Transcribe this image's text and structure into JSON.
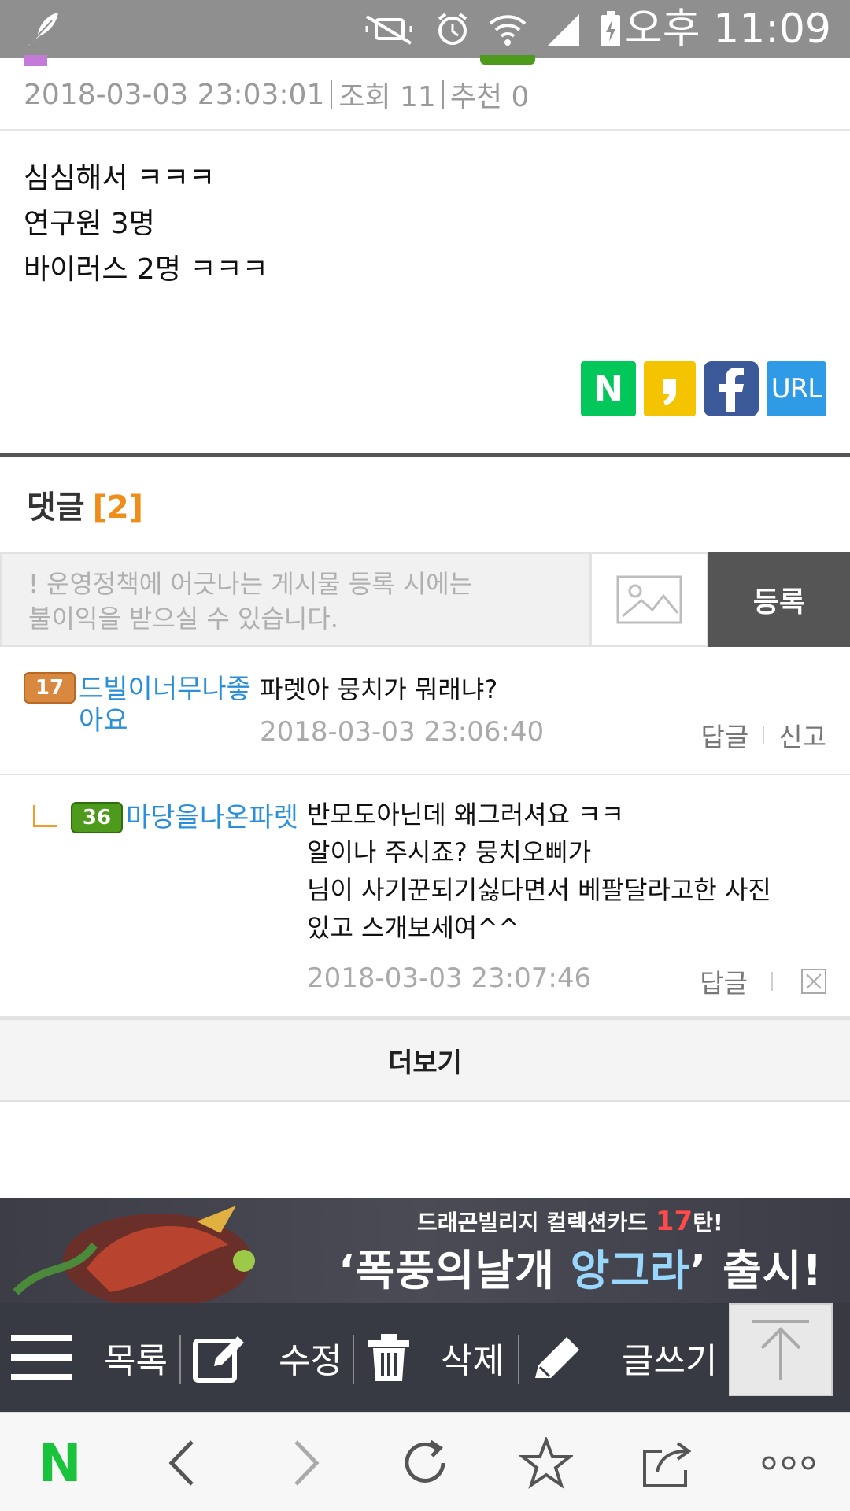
{
  "status_bar": {
    "time": "오후 11:09",
    "icons": [
      "feather-icon",
      "mute-icon",
      "alarm-icon",
      "wifi-icon",
      "signal-icon",
      "battery-charging-icon"
    ]
  },
  "post": {
    "date": "2018-03-03 23:03:01",
    "views": "조회 11",
    "recommend": "추천 0",
    "body_lines": [
      "심심해서 ㅋㅋㅋ",
      "연구원 3명",
      "바이러스 2명 ㅋㅋㅋ"
    ]
  },
  "share": {
    "naver_label": "N",
    "url_label": "URL"
  },
  "comments_header": {
    "title": "댓글",
    "count": "[2]"
  },
  "comment_form": {
    "placeholder_line1": "! 운영정책에 어긋나는 게시물 등록 시에는",
    "placeholder_line2": "불이익을 받으실 수 있습니다.",
    "submit_label": "등록"
  },
  "comments": [
    {
      "level": "17",
      "nick_line1": "드빌이너무나좋",
      "nick_line2": "아요",
      "text": "파렛아 뭉치가 뭐래냐?",
      "date": "2018-03-03 23:06:40",
      "reply_label": "답글",
      "report_label": "신고"
    },
    {
      "level": "36",
      "nick": "마당을나온파렛",
      "text_lines": [
        "반모도아닌데 왜그러셔요 ㅋㅋ",
        "알이나 주시죠? 뭉치오삐가",
        "님이 사기꾼되기싫다면서 베팔달라고한 사진",
        "있고 스개보세여^^"
      ],
      "date": "2018-03-03 23:07:46",
      "reply_label": "답글"
    }
  ],
  "more_label": "더보기",
  "banner": {
    "sub_pre": "드래곤빌리지 컬렉션카드 ",
    "sub_num": "17",
    "sub_post": "탄!",
    "main_pre": "‘폭풍의날개 ",
    "main_hl": "앙그라",
    "main_post": "’ 출시!"
  },
  "actionbar": {
    "list_label": "목록",
    "edit_label": "수정",
    "delete_label": "삭제",
    "write_label": "글쓰기"
  },
  "browser": {
    "logo": "N"
  }
}
